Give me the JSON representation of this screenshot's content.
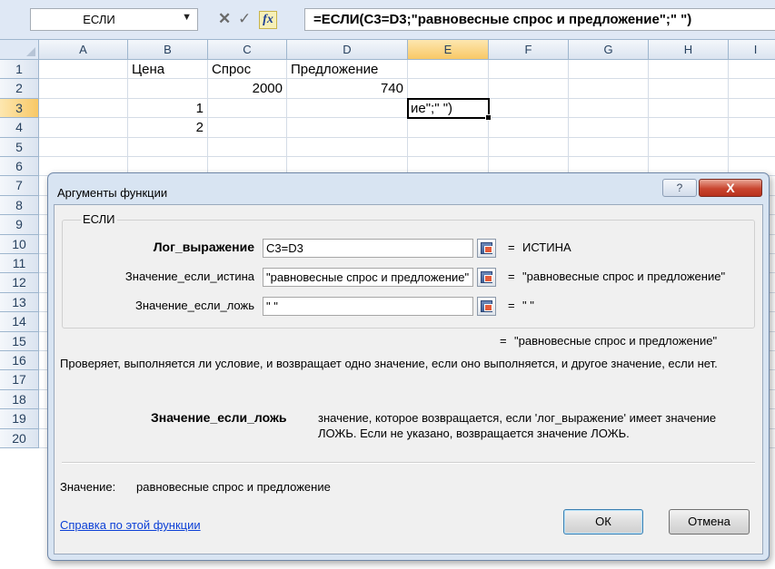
{
  "formula_bar": {
    "name_box": "ЕСЛИ",
    "fx_label": "fx",
    "formula": "=ЕСЛИ(C3=D3;\"равновесные спрос и предложение\";\" \")"
  },
  "sheet": {
    "columns": [
      "A",
      "B",
      "C",
      "D",
      "E",
      "F",
      "G",
      "H",
      "I"
    ],
    "selected_column": "E",
    "rows": [
      "1",
      "2",
      "3",
      "4",
      "5",
      "6",
      "7",
      "8",
      "9",
      "10",
      "11",
      "12",
      "13",
      "14",
      "15",
      "16",
      "17",
      "18",
      "19",
      "20"
    ],
    "selected_row": "3",
    "cells": {
      "B1": "Цена",
      "C1": "Спрос",
      "D1": "Предложение",
      "C2": "2000",
      "D2": "740",
      "B3": "1",
      "B4": "2"
    },
    "active_cell": {
      "ref": "E3",
      "text": "ие\";\" \")"
    }
  },
  "dialog": {
    "title": "Аргументы функции",
    "help_icon": "?",
    "close_icon": "X",
    "function_name": "ЕСЛИ",
    "arguments": [
      {
        "label": "Лог_выражение",
        "value": "C3=D3",
        "result": "ИСТИНА",
        "bold": true
      },
      {
        "label": "Значение_если_истина",
        "value": "\"равновесные спрос и предложение\"",
        "result": "\"равновесные спрос и предложение\"",
        "bold": false
      },
      {
        "label": "Значение_если_ложь",
        "value": "\" \"",
        "result": "\" \"",
        "bold": false
      }
    ],
    "equals_sign": "=",
    "total_result": "\"равновесные спрос и предложение\"",
    "description": "Проверяет, выполняется ли условие, и возвращает одно значение, если оно выполняется, и другое значение, если нет.",
    "arg_desc_name": "Значение_если_ложь",
    "arg_desc_text": "значение, которое возвращается, если 'лог_выражение' имеет значение ЛОЖЬ. Если не указано, возвращается значение ЛОЖЬ.",
    "value_label": "Значение:",
    "value_text": "равновесные спрос и предложение",
    "help_link": "Справка по этой функции",
    "ok_label": "ОК",
    "cancel_label": "Отмена"
  }
}
